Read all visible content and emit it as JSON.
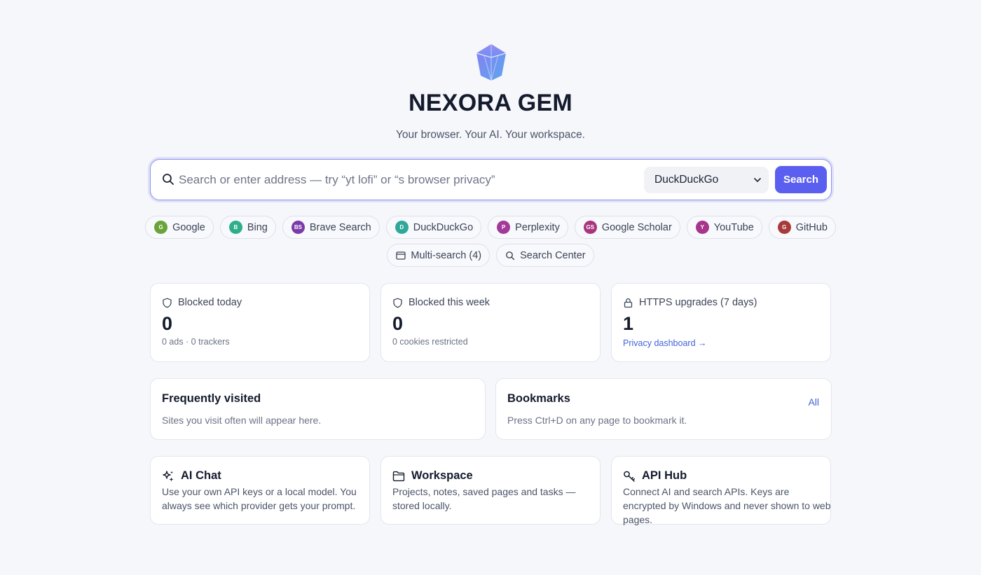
{
  "app": {
    "title": "NEXORA GEM",
    "tagline": "Your browser. Your AI. Your workspace."
  },
  "search": {
    "placeholder": "Search or enter address — try “yt lofi” or “s browser privacy”",
    "engine": "DuckDuckGo",
    "button_label": "Search"
  },
  "engines": [
    {
      "label": "Google",
      "abbr": "G",
      "color": "#6aa33a"
    },
    {
      "label": "Bing",
      "abbr": "B",
      "color": "#2fae8a"
    },
    {
      "label": "Brave Search",
      "abbr": "BS",
      "color": "#7a3aa8"
    },
    {
      "label": "DuckDuckGo",
      "abbr": "D",
      "color": "#2fa89a"
    },
    {
      "label": "Perplexity",
      "abbr": "P",
      "color": "#a33a9a"
    },
    {
      "label": "Google Scholar",
      "abbr": "GS",
      "color": "#a8357e"
    },
    {
      "label": "YouTube",
      "abbr": "Y",
      "color": "#a8358c"
    },
    {
      "label": "GitHub",
      "abbr": "G",
      "color": "#a83a3a"
    }
  ],
  "tools": {
    "multi_search": "Multi-search (4)",
    "search_center": "Search Center"
  },
  "stats": [
    {
      "icon": "shield-icon",
      "label": "Blocked today",
      "value": "0",
      "sub": "0 ads · 0 trackers"
    },
    {
      "icon": "shield-icon",
      "label": "Blocked this week",
      "value": "0",
      "sub": "0 cookies restricted"
    },
    {
      "icon": "lock-icon",
      "label": "HTTPS upgrades (7 days)",
      "value": "1",
      "link": "Privacy dashboard →"
    }
  ],
  "frequent": {
    "title": "Frequently visited",
    "empty": "Sites you visit often will appear here."
  },
  "bookmarks": {
    "title": "Bookmarks",
    "all_label": "All",
    "empty": "Press Ctrl+D on any page to bookmark it."
  },
  "features": [
    {
      "icon": "sparkles-icon",
      "title": "AI Chat",
      "desc": "Use your own API keys or a local model. You always see which provider gets your prompt."
    },
    {
      "icon": "folder-icon",
      "title": "Workspace",
      "desc": "Projects, notes, saved pages and tasks — stored locally."
    },
    {
      "icon": "key-icon",
      "title": "API Hub",
      "desc": "Connect AI and search APIs. Keys are encrypted by Windows and never shown to web pages."
    }
  ],
  "colors": {
    "accent": "#5b5ff0",
    "link": "#3f63d8",
    "background": "#f6f7fb"
  }
}
